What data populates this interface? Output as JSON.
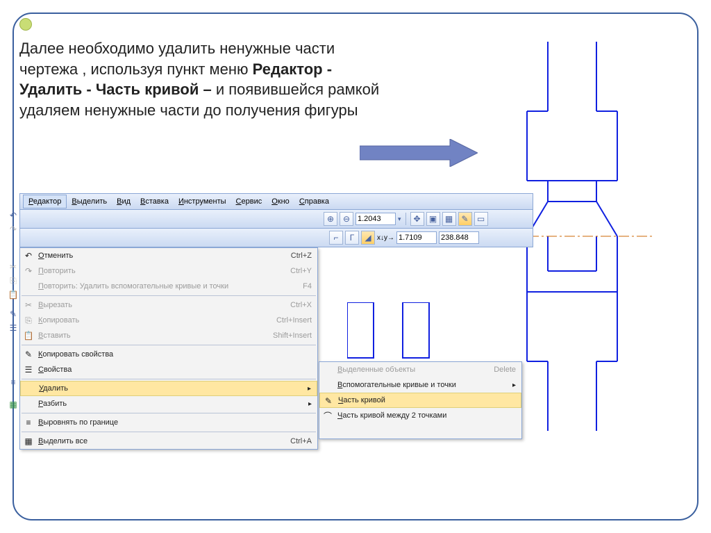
{
  "instruction": {
    "part1": "Далее необходимо удалить ненужные части чертежа , используя пункт меню ",
    "bold1": "Редактор - Удалить  - Часть кривой – ",
    "part2": "и появившейся рамкой удаляем ненужные части до получения  фигуры"
  },
  "menubar": {
    "items": [
      "Редактор",
      "Выделить",
      "Вид",
      "Вставка",
      "Инструменты",
      "Сервис",
      "Окно",
      "Справка"
    ],
    "active": 0
  },
  "toolstrip": {
    "zoom": "1.2043",
    "ycoord": "1.7109",
    "xcoord": "238.848"
  },
  "dropdown": {
    "items": [
      {
        "label": "Отменить",
        "shortcut": "Ctrl+Z",
        "icon": "undo-icon",
        "disabled": false
      },
      {
        "label": "Повторить",
        "shortcut": "Ctrl+Y",
        "icon": "redo-icon",
        "disabled": true
      },
      {
        "label": "Повторить: Удалить вспомогательные кривые и точки",
        "shortcut": "F4",
        "icon": "",
        "disabled": true
      },
      {
        "sep": true
      },
      {
        "label": "Вырезать",
        "shortcut": "Ctrl+X",
        "icon": "cut-icon",
        "disabled": true
      },
      {
        "label": "Копировать",
        "shortcut": "Ctrl+Insert",
        "icon": "copy-icon",
        "disabled": true
      },
      {
        "label": "Вставить",
        "shortcut": "Shift+Insert",
        "icon": "paste-icon",
        "disabled": true
      },
      {
        "sep": true
      },
      {
        "label": "Копировать свойства",
        "shortcut": "",
        "icon": "brush-icon",
        "disabled": false
      },
      {
        "label": "Свойства",
        "shortcut": "",
        "icon": "properties-icon",
        "disabled": false
      },
      {
        "sep": true
      },
      {
        "label": "Удалить",
        "shortcut": "",
        "icon": "",
        "disabled": false,
        "submenu": true,
        "highlight": true
      },
      {
        "label": "Разбить",
        "shortcut": "",
        "icon": "",
        "disabled": false,
        "submenu": true
      },
      {
        "sep": true
      },
      {
        "label": "Выровнять по границе",
        "shortcut": "",
        "icon": "align-icon",
        "disabled": false
      },
      {
        "sep": true
      },
      {
        "label": "Выделить все",
        "shortcut": "Ctrl+A",
        "icon": "select-all-icon",
        "disabled": false
      }
    ]
  },
  "submenu": {
    "items": [
      {
        "label": "Выделенные объекты",
        "shortcut": "Delete",
        "icon": "",
        "disabled": true
      },
      {
        "label": "Вспомогательные кривые и точки",
        "shortcut": "",
        "icon": "",
        "submenu": true
      },
      {
        "label": "Часть кривой",
        "shortcut": "",
        "icon": "curve-icon",
        "highlight": true
      },
      {
        "label": "Часть кривой между 2 точками",
        "shortcut": "",
        "icon": "curve2-icon"
      },
      {
        "label": "",
        "shortcut": "",
        "icon": ""
      }
    ]
  },
  "colors": {
    "frame": "#3a5f9e",
    "arrow": "#7183c3",
    "drawing": "#1020e0",
    "axis": "#cc6600"
  },
  "icons": {
    "undo-icon": "↶",
    "redo-icon": "↷",
    "cut-icon": "✂",
    "copy-icon": "⎘",
    "paste-icon": "📋",
    "brush-icon": "✎",
    "properties-icon": "☰",
    "align-icon": "≡",
    "select-all-icon": "▦",
    "zoom-in-icon": "⊕",
    "zoom-out-icon": "⊖",
    "pan-icon": "✥",
    "fit-icon": "▣",
    "grid-icon": "▦",
    "curve-icon": "✎",
    "curve2-icon": "⌒"
  }
}
